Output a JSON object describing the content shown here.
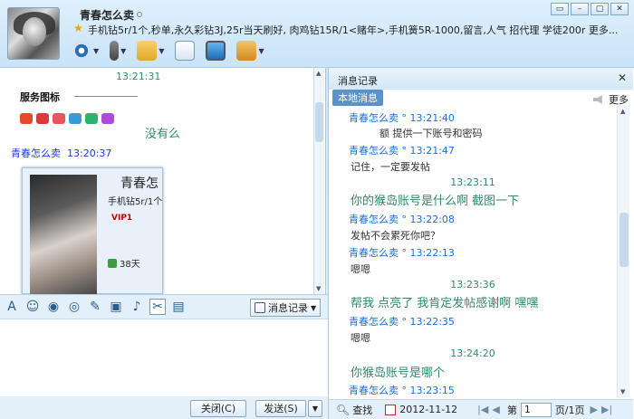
{
  "header": {
    "nickname": "青春怎么卖",
    "signature": "手机钻5r/1个,秒单,永久彩钻3J,25r当天刷好, 肉鸡钻15R/1<赌年>,手机簧5R-1000,留言,人气 招代理  学徒200r 更多..."
  },
  "window_buttons": [
    "▭",
    "–",
    "▢",
    "✕"
  ],
  "toolbar": {
    "items": [
      "video-call",
      "voice-call",
      "send-file",
      "create-group",
      "remote-assist",
      "apps"
    ]
  },
  "left_chat": {
    "timestamp": "13:21:31",
    "service_icon_title": "服务图标",
    "reply1": "没有么",
    "sender": "青春怎么卖",
    "sender_time": "13:20:37",
    "card": {
      "name": "青春怎",
      "signature": "手机钻5r/1个",
      "vip": "VIP1",
      "days": "38天"
    }
  },
  "input_toolbar": {
    "history_label": "消息记录"
  },
  "bottom": {
    "close_label": "关闭(C)",
    "send_label": "发送(S)"
  },
  "history": {
    "title": "消息记录",
    "tab": "本地消息",
    "more": "更多",
    "entries": [
      {
        "sender": "青春怎么卖",
        "time": "13:21:40",
        "text": "额    提供一下账号和密码"
      },
      {
        "sender": "青春怎么卖",
        "time": "13:21:47",
        "text": "记住，一定要发帖"
      },
      {
        "stamp": "13:23:11",
        "big": "你的猴岛账号是什么啊  截图一下"
      },
      {
        "sender": "青春怎么卖",
        "time": "13:22:08",
        "text": "发帖不会累死你吧？"
      },
      {
        "sender": "青春怎么卖",
        "time": "13:22:13",
        "text": "嗯嗯"
      },
      {
        "stamp": "13:23:36",
        "big": "帮我 点亮了 我肯定发帖感谢啊   嘿嘿"
      },
      {
        "sender": "青春怎么卖",
        "time": "13:22:35",
        "text": "嗯嗯"
      },
      {
        "stamp": "13:24:20",
        "big": "你猴岛账号是哪个"
      },
      {
        "sender": "青春怎么卖",
        "time": "13:23:15",
        "text": ""
      }
    ],
    "footer": {
      "search": "查找",
      "date": "2012-11-12",
      "page_prefix": "第",
      "page_value": "1",
      "page_suffix": "页/1页"
    }
  }
}
